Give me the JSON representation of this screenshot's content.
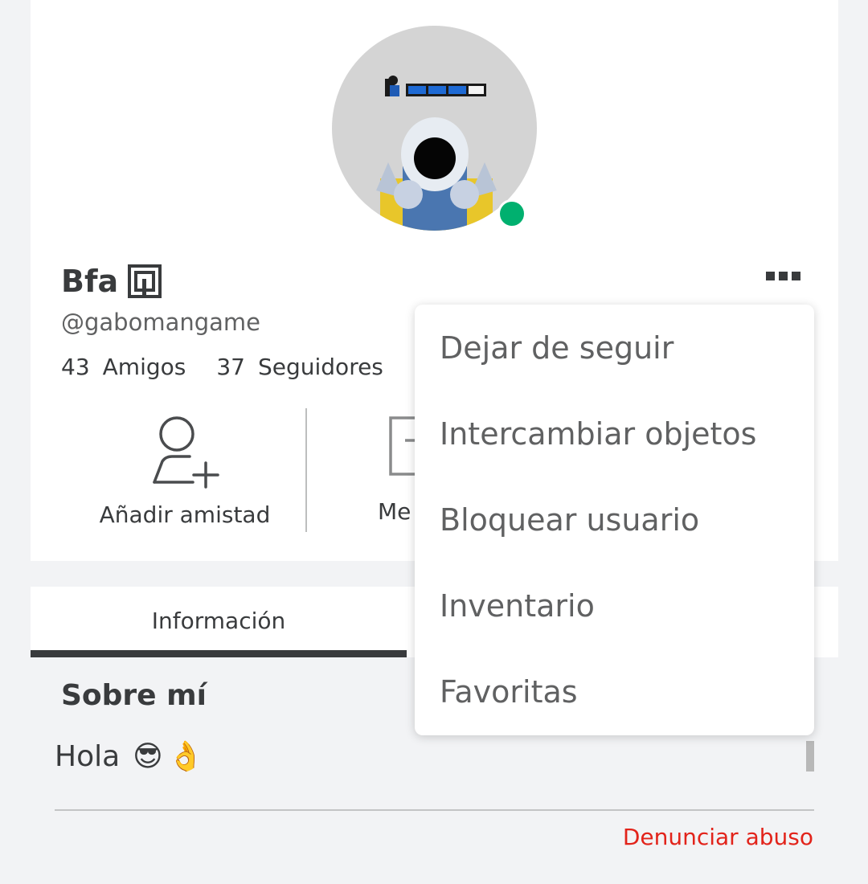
{
  "profile": {
    "display_name": "Bfa",
    "username": "@gabomangame",
    "online_color": "#00b06f",
    "stats": {
      "friends_count": "43",
      "friends_label": "Amigos",
      "followers_count": "37",
      "followers_label": "Seguidores"
    }
  },
  "actions": {
    "add_friend_label": "Añadir amistad",
    "message_label": "Me"
  },
  "menu": {
    "items": [
      {
        "label": "Dejar de seguir"
      },
      {
        "label": "Intercambiar objetos"
      },
      {
        "label": "Bloquear usuario"
      },
      {
        "label": "Inventario"
      },
      {
        "label": "Favoritas"
      }
    ]
  },
  "tabs": {
    "info_label": "Información"
  },
  "about": {
    "title": "Sobre mí",
    "text": "Hola",
    "emojis": [
      "😎",
      "👌"
    ]
  },
  "footer": {
    "report_label": "Denunciar abuso",
    "report_color": "#e2231a"
  },
  "icons": {
    "premium": "premium-icon",
    "more": "more-icon",
    "add_friend": "add-friend-icon",
    "message": "message-icon"
  }
}
